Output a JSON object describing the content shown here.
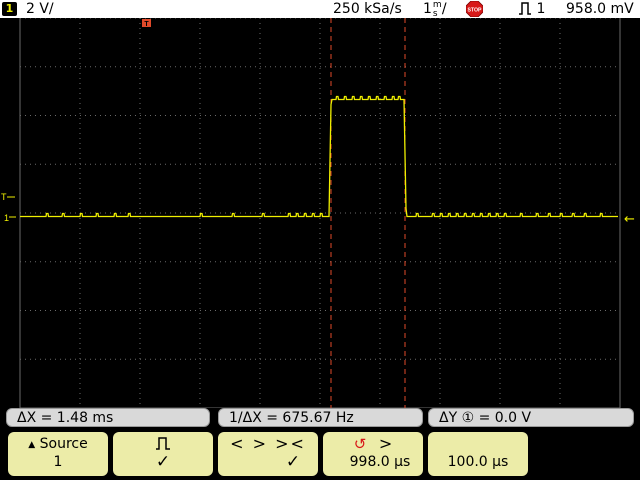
{
  "status": {
    "channel_number": "1",
    "vertical_scale": "2 V/",
    "sample_rate": "250 kSa/s",
    "time_scale": "1",
    "time_scale_unit_top": "m",
    "time_scale_unit_bottom": "s",
    "time_scale_suffix": "/",
    "run_state": "STOP",
    "trigger_source": "1",
    "trigger_level": "958.0 mV"
  },
  "markers": {
    "trigger_level": "T",
    "channel_ground": "1",
    "right_level": "←"
  },
  "measurements": {
    "delta_x": "ΔX =  1.48 ms",
    "inverse_delta_x": "1/ΔX = 675.67  Hz",
    "delta_y": "ΔY ① = 0.0 V"
  },
  "softkeys": {
    "source_label": "Source",
    "source_value": "1",
    "edge_check": "✓",
    "mode_arrows": "< > ><",
    "mode_check": "✓",
    "cursor_arrow": ">",
    "cursor_value": "998.0 µs",
    "fine_value": "100.0 µs"
  },
  "colors": {
    "trace": "#f0f000",
    "cursor": "#e04a2a",
    "grid": "#707070",
    "softkey": "#ececa8",
    "measure_box": "#d9d9d9"
  }
}
